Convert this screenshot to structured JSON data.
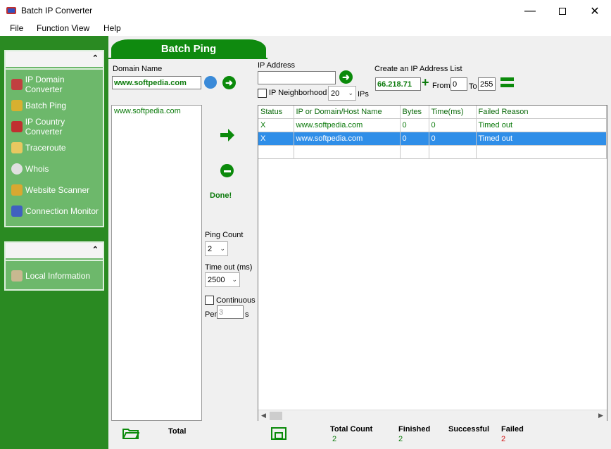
{
  "window": {
    "title": "Batch IP Converter"
  },
  "menu": [
    "File",
    "Function View",
    "Help"
  ],
  "sidebar": {
    "group1_items": [
      {
        "label": "IP Domain Converter"
      },
      {
        "label": "Batch Ping"
      },
      {
        "label": "IP Country Converter"
      },
      {
        "label": "Traceroute"
      },
      {
        "label": "Whois"
      },
      {
        "label": "Website Scanner"
      },
      {
        "label": "Connection Monitor"
      }
    ],
    "group2_items": [
      {
        "label": "Local Information"
      }
    ],
    "collapse_glyph": "⌃"
  },
  "panel": {
    "header": "Batch Ping",
    "domain_label": "Domain  Name",
    "domain_value": "www.softpedia.com",
    "domain_list": [
      "www.softpedia.com"
    ],
    "status_text": "Done!",
    "ping_count_label": "Ping Count",
    "ping_count_value": "2",
    "timeout_label": "Time out (ms)",
    "timeout_value": "2500",
    "continuous_label": "Continuous",
    "per_label": "Per",
    "per_value": "3",
    "per_unit": "s"
  },
  "ip": {
    "label": "IP Address",
    "value": "",
    "neighborhood_label": "IP Neighborhood",
    "neighborhood_count": "20",
    "ips_label": "IPs"
  },
  "iplist": {
    "label": "Create an IP Address List",
    "base": "66.218.71",
    "from_label": "From",
    "from_value": "0",
    "to_label": "To",
    "to_value": "255"
  },
  "grid": {
    "columns": [
      "Status",
      "IP or Domain/Host Name",
      "Bytes",
      "Time(ms)",
      "Failed Reason"
    ],
    "rows": [
      {
        "status": "X",
        "host": "www.softpedia.com",
        "bytes": "0",
        "time": "0",
        "reason": "Timed out"
      },
      {
        "status": "X",
        "host": "www.softpedia.com",
        "bytes": "0",
        "time": "0",
        "reason": "Timed out"
      }
    ]
  },
  "footer": {
    "total_label": "Total",
    "total_count_label": "Total Count",
    "total_count_value": "2",
    "finished_label": "Finished",
    "finished_value": "2",
    "successful_label": "Successful",
    "successful_value": "",
    "failed_label": "Failed",
    "failed_value": "2"
  },
  "colors": {
    "accent_green": "#0b8a0b",
    "sidebar_green": "#2a8a22",
    "selection_blue": "#2f8ee8",
    "failed_red": "#d01010"
  }
}
